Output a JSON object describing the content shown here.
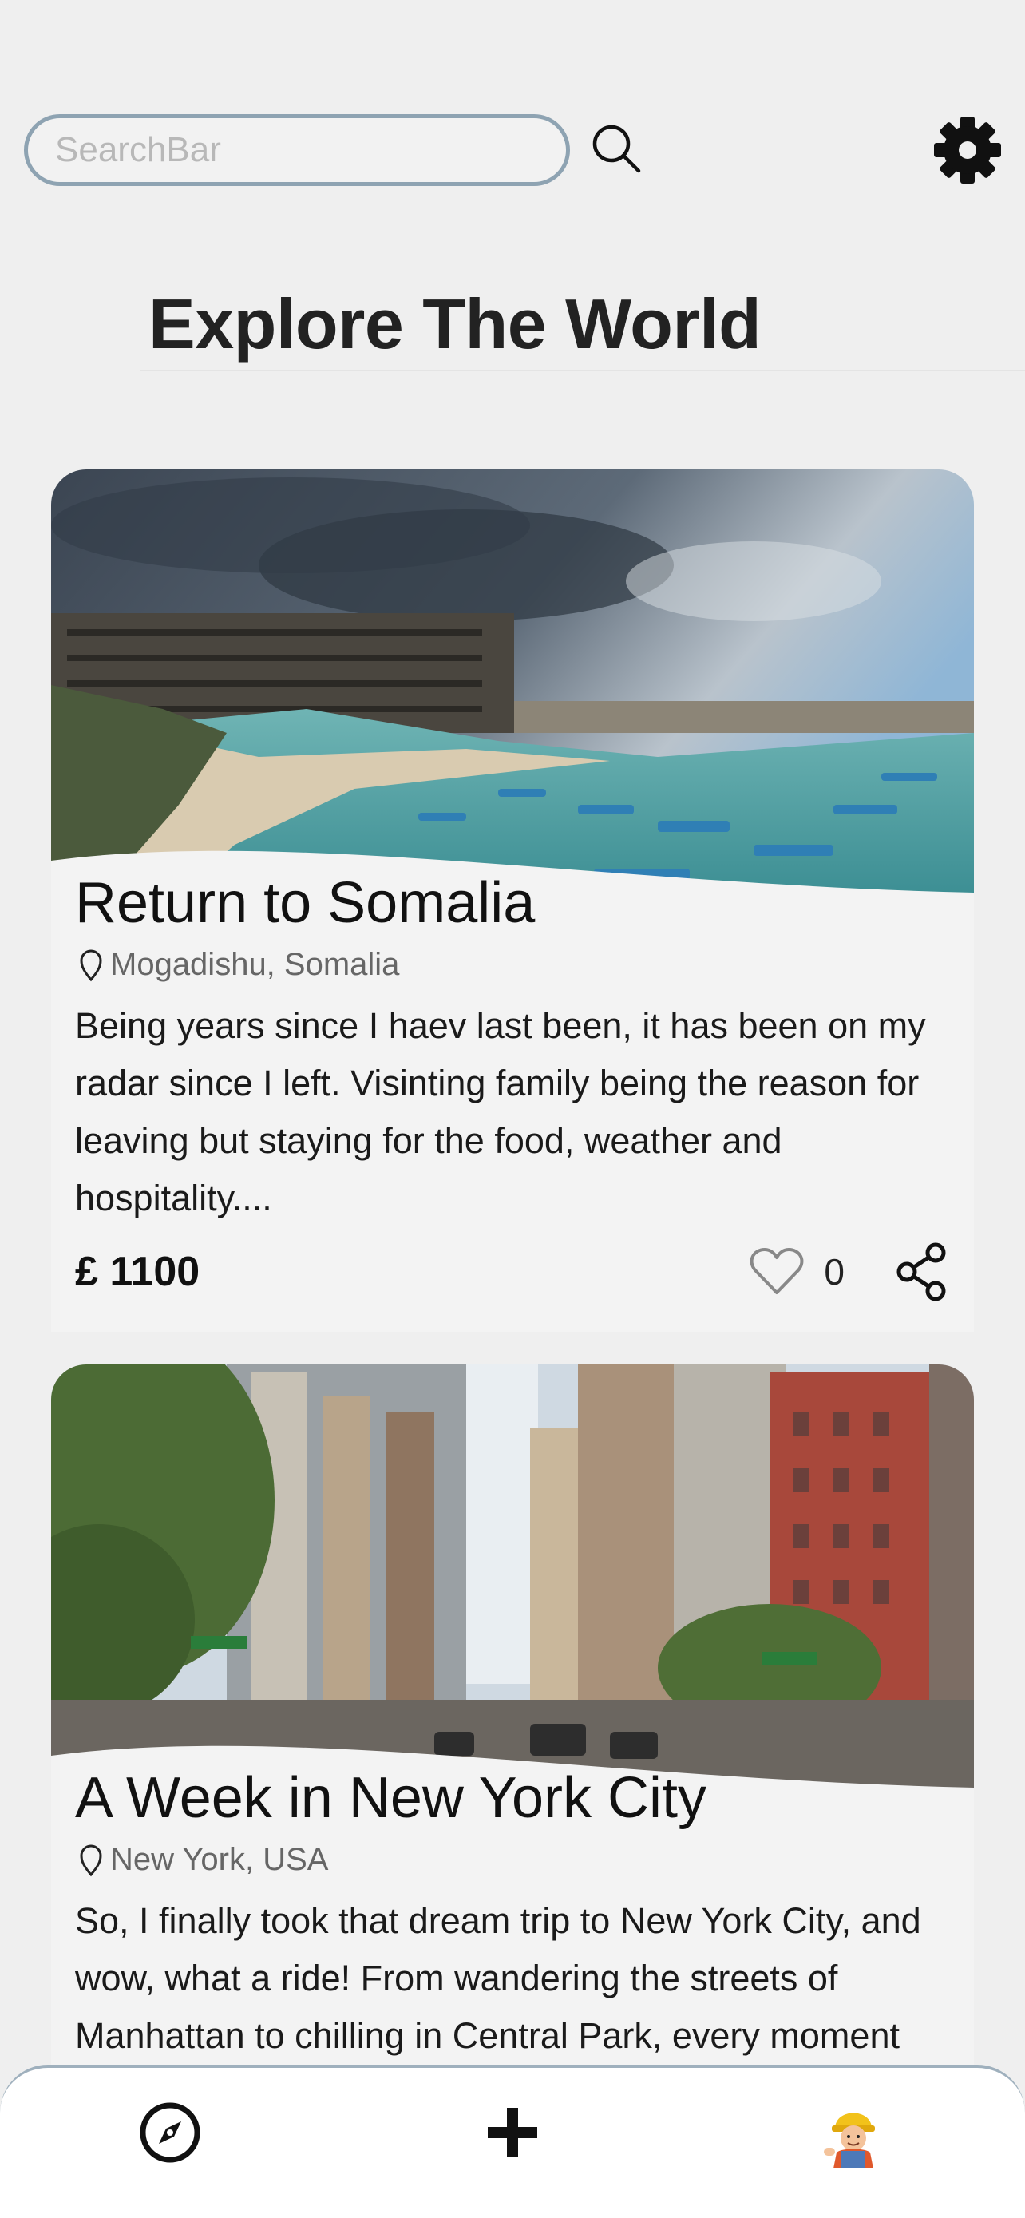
{
  "header": {
    "search_placeholder": "SearchBar"
  },
  "page_title": "Explore The World",
  "posts": [
    {
      "title": "Return to Somalia",
      "location": "Mogadishu, Somalia",
      "text": "Being years since I haev last been, it has been on my radar since I left. Visinting family being the reason for leaving but staying for the food, weather and hospitality....",
      "price": "£ 1100",
      "likes": "0"
    },
    {
      "title": "A Week in New York City",
      "location": "New York, USA",
      "text": "So, I finally took that dream trip to New York City, and wow, what a ride! From wandering the streets of Manhattan to chilling in Central Park, every moment"
    }
  ],
  "nav": {
    "items": [
      "explore-icon",
      "add-icon",
      "profile-avatar"
    ]
  },
  "colors": {
    "background": "#efefef",
    "card": "#f3f3f3",
    "search_border": "#8ea3b2",
    "nav_border": "#9fb0bd"
  }
}
